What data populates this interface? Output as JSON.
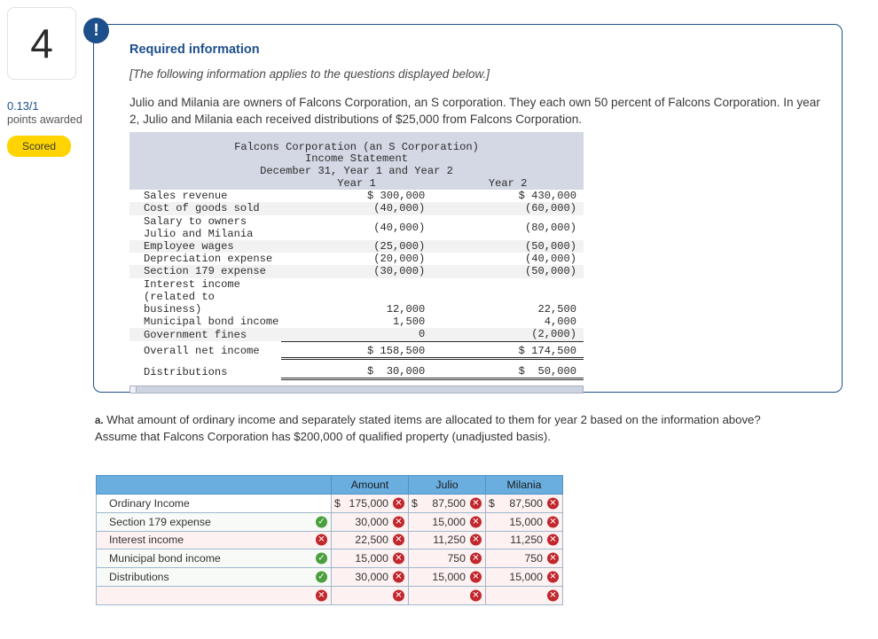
{
  "left_rail": {
    "question_number": "4",
    "points_value": "0.13/1",
    "points_label": "points awarded",
    "status_badge": "Scored"
  },
  "info_panel": {
    "alert_icon_glyph": "!",
    "title": "Required information",
    "applies_note": "[The following information applies to the questions displayed below.]",
    "intro_paragraph": "Julio and Milania are owners of Falcons Corporation, an S corporation. They each own 50 percent of Falcons Corporation. In year 2, Julio and Milania each received distributions of $25,000 from Falcons Corporation."
  },
  "income_statement": {
    "title_line1": "Falcons Corporation (an S Corporation)",
    "title_line2": "Income Statement",
    "title_line3": "December 31, Year 1 and Year 2",
    "col_year1": "Year 1",
    "col_year2": "Year 2",
    "rows": [
      {
        "label": "Sales revenue",
        "year1": "$ 300,000",
        "year2": "$ 430,000"
      },
      {
        "label": "Cost of goods sold",
        "year1": "(40,000)",
        "year2": "(60,000)"
      },
      {
        "label": "Salary to owners Julio and Milania",
        "year1": "(40,000)",
        "year2": "(80,000)"
      },
      {
        "label": "Employee wages",
        "year1": "(25,000)",
        "year2": "(50,000)"
      },
      {
        "label": "Depreciation expense",
        "year1": "(20,000)",
        "year2": "(40,000)"
      },
      {
        "label": "Section 179 expense",
        "year1": "(30,000)",
        "year2": "(50,000)"
      },
      {
        "label": "Interest income (related to",
        "year1": "",
        "year2": ""
      },
      {
        "label": "  business)",
        "year1": "12,000",
        "year2": "22,500"
      },
      {
        "label": "Municipal bond income",
        "year1": "1,500",
        "year2": "4,000"
      },
      {
        "label": "Government fines",
        "year1": "0",
        "year2": "(2,000)"
      }
    ],
    "total_row": {
      "label": "Overall net income",
      "year1": "$ 158,500",
      "year2": "$ 174,500"
    },
    "distributions_row": {
      "label": "Distributions",
      "year1": "$  30,000",
      "year2": "$  50,000"
    }
  },
  "question": {
    "label": "a.",
    "line1": " What amount of ordinary income and separately stated items are allocated to them for year 2 based on the information above?",
    "line2": "Assume that Falcons Corporation has $200,000 of qualified property (unadjusted basis)."
  },
  "answer_table": {
    "headers": [
      "",
      "Amount",
      "Julio",
      "Milania"
    ],
    "rows": [
      {
        "label": "Ordinary Income",
        "label_mark": "",
        "amount": {
          "dollar": "$",
          "value": "175,000",
          "mark": "wrong"
        },
        "julio": {
          "dollar": "$",
          "value": "87,500",
          "mark": "wrong"
        },
        "milania": {
          "dollar": "$",
          "value": "87,500",
          "mark": "wrong"
        }
      },
      {
        "label": "Section 179 expense",
        "label_mark": "right",
        "amount": {
          "dollar": "",
          "value": "30,000",
          "mark": "wrong"
        },
        "julio": {
          "dollar": "",
          "value": "15,000",
          "mark": "wrong"
        },
        "milania": {
          "dollar": "",
          "value": "15,000",
          "mark": "wrong"
        }
      },
      {
        "label": "Interest income",
        "label_mark": "wrong",
        "amount": {
          "dollar": "",
          "value": "22,500",
          "mark": "wrong"
        },
        "julio": {
          "dollar": "",
          "value": "11,250",
          "mark": "wrong"
        },
        "milania": {
          "dollar": "",
          "value": "11,250",
          "mark": "wrong"
        }
      },
      {
        "label": "Municipal bond income",
        "label_mark": "right",
        "amount": {
          "dollar": "",
          "value": "15,000",
          "mark": "wrong"
        },
        "julio": {
          "dollar": "",
          "value": "750",
          "mark": "wrong"
        },
        "milania": {
          "dollar": "",
          "value": "750",
          "mark": "wrong"
        }
      },
      {
        "label": "Distributions",
        "label_mark": "right",
        "amount": {
          "dollar": "",
          "value": "30,000",
          "mark": "wrong"
        },
        "julio": {
          "dollar": "",
          "value": "15,000",
          "mark": "wrong"
        },
        "milania": {
          "dollar": "",
          "value": "15,000",
          "mark": "wrong"
        }
      },
      {
        "label": "",
        "label_mark": "wrong",
        "amount": {
          "dollar": "",
          "value": "",
          "mark": "wrong"
        },
        "julio": {
          "dollar": "",
          "value": "",
          "mark": "wrong"
        },
        "milania": {
          "dollar": "",
          "value": "",
          "mark": "wrong"
        }
      }
    ]
  },
  "colors": {
    "brand_blue": "#1d4f8c",
    "badge_yellow": "#ffd400",
    "table_header_blue": "#6aaee0",
    "statement_header_gray": "#d3d8e4",
    "mark_wrong_red": "#c1272d",
    "mark_right_green": "#4a9f3e"
  }
}
